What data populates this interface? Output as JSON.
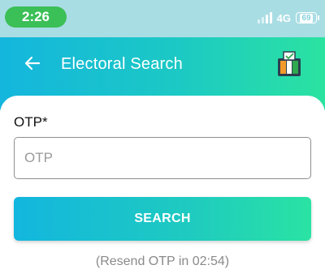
{
  "status_bar": {
    "time": "2:26",
    "network": "4G",
    "battery": "69"
  },
  "header": {
    "title": "Electoral Search"
  },
  "form": {
    "otp_label": "OTP*",
    "otp_placeholder": "OTP",
    "otp_value": "",
    "search_label": "SEARCH",
    "resend_text": "(Resend OTP in  02:54)"
  },
  "colors": {
    "header_start": "#14b6dd",
    "header_end": "#2be3a0",
    "status_bar": "#a9dde4",
    "time_pill": "#3bbf57"
  },
  "icons": {
    "back": "arrow-left-icon",
    "logo": "ballot-box-logo-icon",
    "signal": "signal-icon",
    "battery": "battery-icon"
  }
}
